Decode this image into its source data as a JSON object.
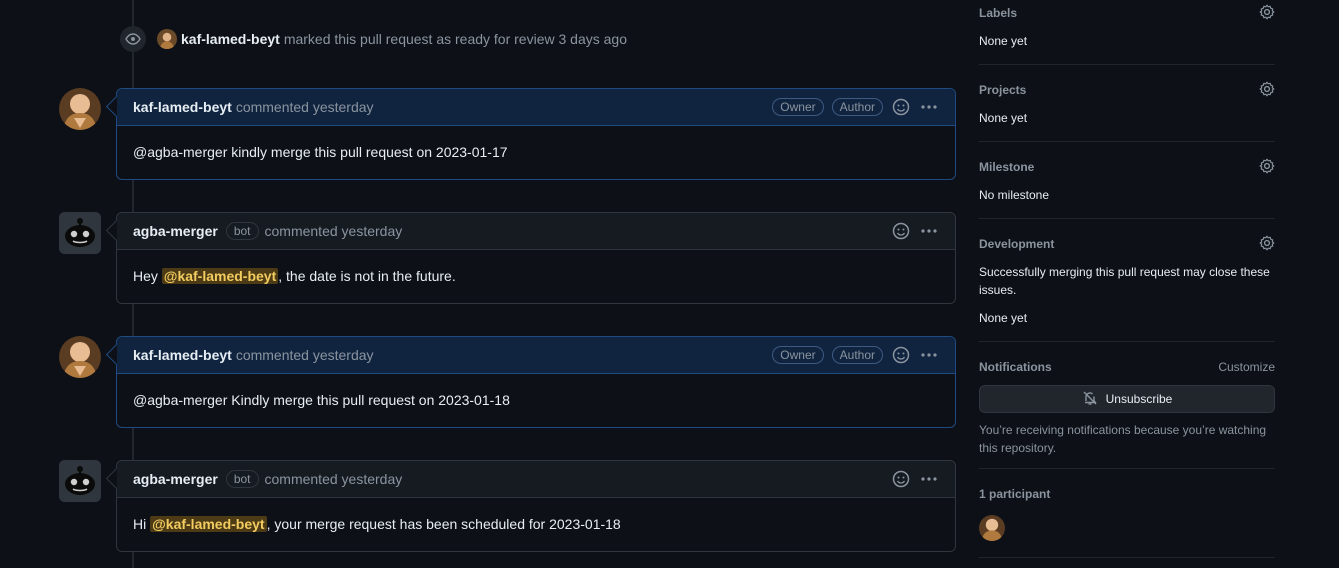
{
  "timeline_event": {
    "author": "kaf-lamed-beyt",
    "text": "marked this pull request as ready for review 3 days ago",
    "icon": "eye-icon"
  },
  "comments": [
    {
      "author": "kaf-lamed-beyt",
      "meta": "commented yesterday",
      "badges": [
        "Owner",
        "Author"
      ],
      "body": "@agba-merger kindly merge this pull request on 2023-01-17"
    },
    {
      "author": "agba-merger",
      "bot_label": "bot",
      "meta": "commented yesterday",
      "body_prefix": "Hey ",
      "mention": "@kaf-lamed-beyt",
      "body_suffix": ", the date is not in the future."
    },
    {
      "author": "kaf-lamed-beyt",
      "meta": "commented yesterday",
      "badges": [
        "Owner",
        "Author"
      ],
      "body": "@agba-merger Kindly merge this pull request on 2023-01-18"
    },
    {
      "author": "agba-merger",
      "bot_label": "bot",
      "meta": "commented yesterday",
      "body_prefix": "Hi ",
      "mention": "@kaf-lamed-beyt",
      "body_suffix": ", your merge request has been scheduled for 2023-01-18"
    }
  ],
  "sidebar": {
    "labels": {
      "title": "Labels",
      "value": "None yet"
    },
    "projects": {
      "title": "Projects",
      "value": "None yet"
    },
    "milestone": {
      "title": "Milestone",
      "value": "No milestone"
    },
    "development": {
      "title": "Development",
      "note": "Successfully merging this pull request may close these issues.",
      "value": "None yet"
    },
    "notifications": {
      "title": "Notifications",
      "customize": "Customize",
      "button": "Unsubscribe",
      "note": "You’re receiving notifications because you’re watching this repository."
    },
    "participants": {
      "title": "1 participant"
    }
  },
  "colors": {
    "background": "#0d1117",
    "owner_header": "#102440",
    "mention_bg": "#4d3b15",
    "mention_fg": "#f2cc60"
  }
}
